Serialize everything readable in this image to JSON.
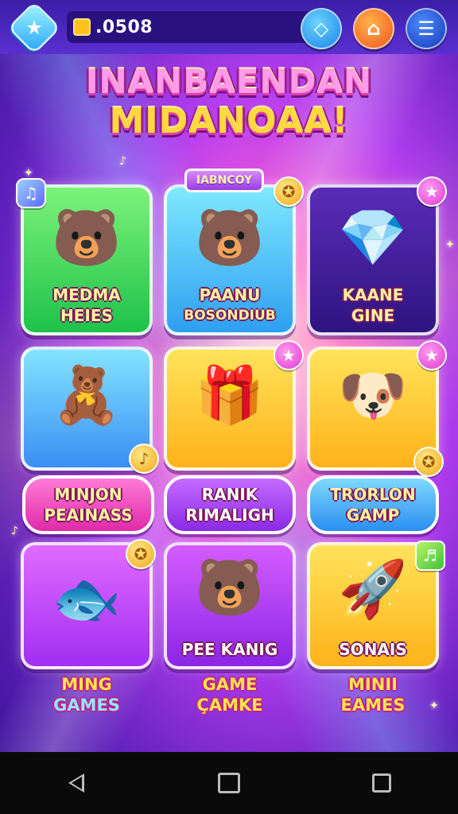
{
  "topbar": {
    "coins": ".0508",
    "icons": {
      "profile": "star-icon",
      "diamond": "diamond-icon",
      "shop": "shop-icon",
      "menu": "hamburger-menu-icon"
    }
  },
  "title": {
    "line1": "INANBAENDAN",
    "line2": "MIDANOAA!"
  },
  "ribbon": "IABNCOY",
  "tiles": [
    {
      "label1": "MEDMA",
      "label2": "HEIES",
      "icon": "bear-icon",
      "color": "#1ec24a"
    },
    {
      "label1": "PAANU",
      "label2": "BOSONDIUB",
      "icon": "bear-icon",
      "color": "#2e9ff0"
    },
    {
      "label1": "KAANE",
      "label2": "GINE",
      "icon": "crystal-icon",
      "color": "#2e1480"
    },
    {
      "label1": "",
      "label2": "",
      "icon": "purple-bear-icon",
      "color": "#3b8ef2"
    },
    {
      "label1": "",
      "label2": "",
      "icon": "candy-gift-icon",
      "color": "#ffb21a"
    },
    {
      "label1": "",
      "label2": "",
      "icon": "puppy-icon",
      "color": "#ffb21a"
    },
    {
      "label1": "",
      "label2": "",
      "icon": "rainbow-fish-icon",
      "color": "#a12ef2"
    },
    {
      "label1": "PEE KANIG",
      "label2": "",
      "icon": "bear-icon",
      "color": "#8b26e6"
    },
    {
      "label1": "SONAIS",
      "label2": "",
      "icon": "rocket-fish-icon",
      "color": "#ffb21a"
    }
  ],
  "pills": [
    {
      "line1": "MINJON",
      "line2": "PEAINASS"
    },
    {
      "line1": "RANIK",
      "line2": "RIMALIGH"
    },
    {
      "line1": "TRORLON",
      "line2": "GAMP"
    }
  ],
  "bottom_labels": [
    {
      "line1": "MING",
      "line2": "GAMES"
    },
    {
      "line1": "GAME",
      "line2": "ÇAMKE"
    },
    {
      "line1": "MINII",
      "line2": "EAMES"
    }
  ],
  "navbar": {
    "icons": [
      "back-icon",
      "home-icon",
      "recents-icon"
    ]
  }
}
